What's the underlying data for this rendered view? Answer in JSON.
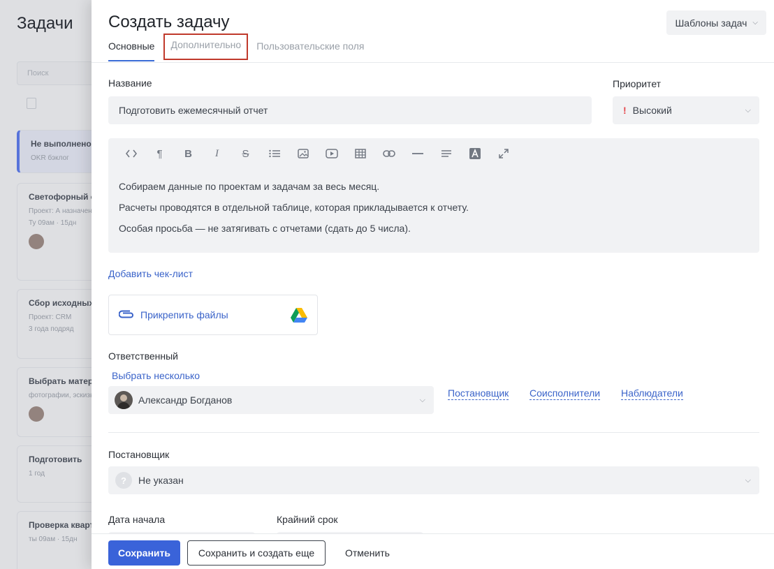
{
  "background": {
    "title": "Задачи",
    "filter_text": "Поиск",
    "cards": [
      {
        "line1": "Не выполнено",
        "line2": "OKR бэклог",
        "line3": "",
        "active": true
      },
      {
        "line1": "Светофорный отчет",
        "line2": "Проект: А назначено",
        "line3": "Ту 09ам · 15дн"
      },
      {
        "line1": "Сбор исходных данных",
        "line2": "Проект: CRM",
        "line3": "3 года подряд"
      },
      {
        "line1": "Выбрать материал",
        "line2": "фотографии, эскизы",
        "line3": ""
      },
      {
        "line1": "Подготовить",
        "line2": "1 год",
        "line3": ""
      },
      {
        "line1": "Проверка квартальных",
        "line2": "ты 09ам · 15дн",
        "line3": ""
      }
    ]
  },
  "modal": {
    "title": "Создать задачу",
    "templates_button": "Шаблоны задач",
    "tabs": [
      {
        "label": "Основные"
      },
      {
        "label": "Дополнительно"
      },
      {
        "label": "Пользовательские поля"
      }
    ],
    "name": {
      "label": "Название",
      "value": "Подготовить ежемесячный отчет"
    },
    "priority": {
      "label": "Приоритет",
      "value": "Высокий",
      "marker": "!",
      "marker_color": "#e5484d"
    },
    "editor": {
      "toolbar": [
        "code-icon",
        "paragraph-icon",
        "bold-icon",
        "italic-icon",
        "strikethrough-icon",
        "list-icon",
        "image-icon",
        "video-icon",
        "table-icon",
        "link-icon",
        "horizontal-rule-icon",
        "align-icon",
        "text-color-icon",
        "fullscreen-icon"
      ],
      "lines": [
        "Собираем данные по проектам и задачам за весь месяц.",
        "Расчеты проводятся в отдельной таблице, которая прикладывается к отчету.",
        "Особая просьба — не затягивать с отчетами (сдать до 5 числа)."
      ]
    },
    "add_checklist": "Добавить чек-лист",
    "attach_files": "Прикрепить файлы",
    "responsible": {
      "label": "Ответственный",
      "select_multiple": "Выбрать несколько",
      "value": "Александр Богданов",
      "links": [
        "Постановщик",
        "Соисполнители",
        "Наблюдатели"
      ]
    },
    "author": {
      "label": "Постановщик",
      "value": "Не указан",
      "icon_text": "?"
    },
    "start_date": {
      "label": "Дата начала"
    },
    "deadline": {
      "label": "Крайний срок"
    },
    "footer": {
      "save": "Сохранить",
      "save_and_new": "Сохранить и создать еще",
      "cancel": "Отменить"
    },
    "colors": {
      "accent": "#3a63d9",
      "link": "#3a63c9",
      "tab_highlight_border": "#c0392b"
    }
  }
}
